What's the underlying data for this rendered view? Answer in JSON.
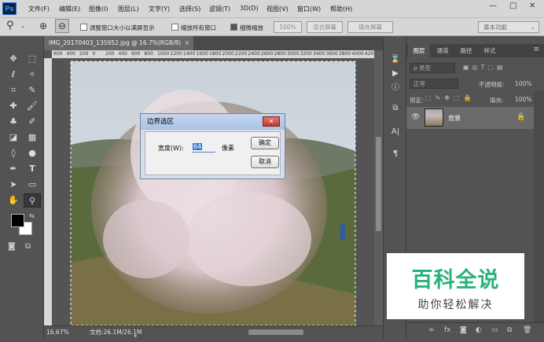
{
  "app": {
    "logo": "Ps"
  },
  "menu": [
    "文件(F)",
    "编辑(E)",
    "图像(I)",
    "图层(L)",
    "文字(Y)",
    "选择(S)",
    "滤镜(T)",
    "3D(D)",
    "视图(V)",
    "窗口(W)",
    "帮助(H)"
  ],
  "window_controls": {
    "minimize": "—",
    "restore": "□",
    "close": "✕"
  },
  "options": {
    "resize_windows_label": "调整窗口大小以满屏显示",
    "zoom_all_label": "缩放所有窗口",
    "scrubby_zoom_label": "细微缩放",
    "pct_button": "100%",
    "fit_button": "适合屏幕",
    "fill_button": "填充屏幕",
    "workspace": "基本功能"
  },
  "document": {
    "tab_title": "IMG_20170403_135952.jpg @ 16.7%(RGB/8)",
    "tab_close": "×",
    "zoom": "16.67%",
    "doc_info": "文档:26.1M/26.1M",
    "ruler_ticks": [
      "600",
      "400",
      "200",
      "0",
      "200",
      "400",
      "600",
      "800",
      "1000",
      "1200",
      "1400",
      "1600",
      "1800",
      "2000",
      "2200",
      "2400",
      "2600",
      "2800",
      "3000",
      "3200",
      "3400",
      "3600",
      "3800",
      "4000",
      "4200"
    ]
  },
  "dialog": {
    "title": "边界选区",
    "width_label": "宽度(W):",
    "width_value": "64",
    "unit": "像素",
    "ok": "确定",
    "cancel": "取消",
    "close_glyph": "✕"
  },
  "layers_panel": {
    "tabs": [
      "图层",
      "通道",
      "路径",
      "样式"
    ],
    "kind_filter": "ρ 类型",
    "blend_mode": "正常",
    "opacity_label": "不透明度:",
    "opacity_value": "100%",
    "lock_label": "锁定:",
    "fill_label": "填充:",
    "fill_value": "100%",
    "layer_name": "背景"
  },
  "colors": {
    "foreground": "#000000",
    "background": "#ffffff",
    "accent": "#3a78d6"
  },
  "watermark": {
    "line1": "百科全说",
    "line2": "助你轻松解决"
  }
}
